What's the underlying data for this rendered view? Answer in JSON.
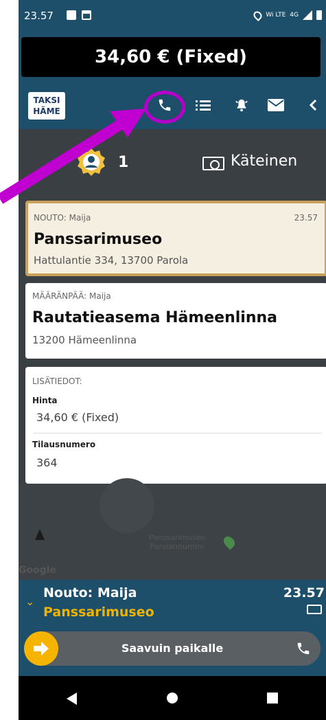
{
  "status": {
    "time": "23.57",
    "network": "4G",
    "lte": "Wi LTE"
  },
  "fare": {
    "label": "34,60 € (Fixed)"
  },
  "toolbar": {
    "logo_line1": "TAKSI",
    "logo_line2": "HÄME",
    "icons": [
      "phone-icon",
      "list-icon",
      "bell-icon",
      "mail-icon",
      "chevron-left-icon"
    ]
  },
  "info": {
    "passengers": "1",
    "payment": "Käteinen"
  },
  "pickup": {
    "label": "NOUTO: Maija",
    "time": "23.57",
    "title": "Panssarimuseo",
    "address": "Hattulantie 334, 13700 Parola"
  },
  "destination": {
    "label": "MÄÄRÄNPÄÄ: Maija",
    "title": "Rautatieasema Hämeenlinna",
    "address": "13200 Hämeenlinna"
  },
  "extra": {
    "label": "LISÄTIEDOT:",
    "price_label": "Hinta",
    "price_value": "34,60 € (Fixed)",
    "order_label": "Tilausnumero",
    "order_value": "364"
  },
  "map": {
    "poi": "Panssarimuseo\nParolannummi",
    "attribution": "Google"
  },
  "bottom": {
    "title": "Nouto: Maija",
    "subtitle": "Panssarimuseo",
    "time": "23.57",
    "slider_label": "Saavuin paikalle"
  },
  "colors": {
    "accent": "#f0b400",
    "header": "#1d4f6b",
    "highlight": "#b400c8"
  }
}
